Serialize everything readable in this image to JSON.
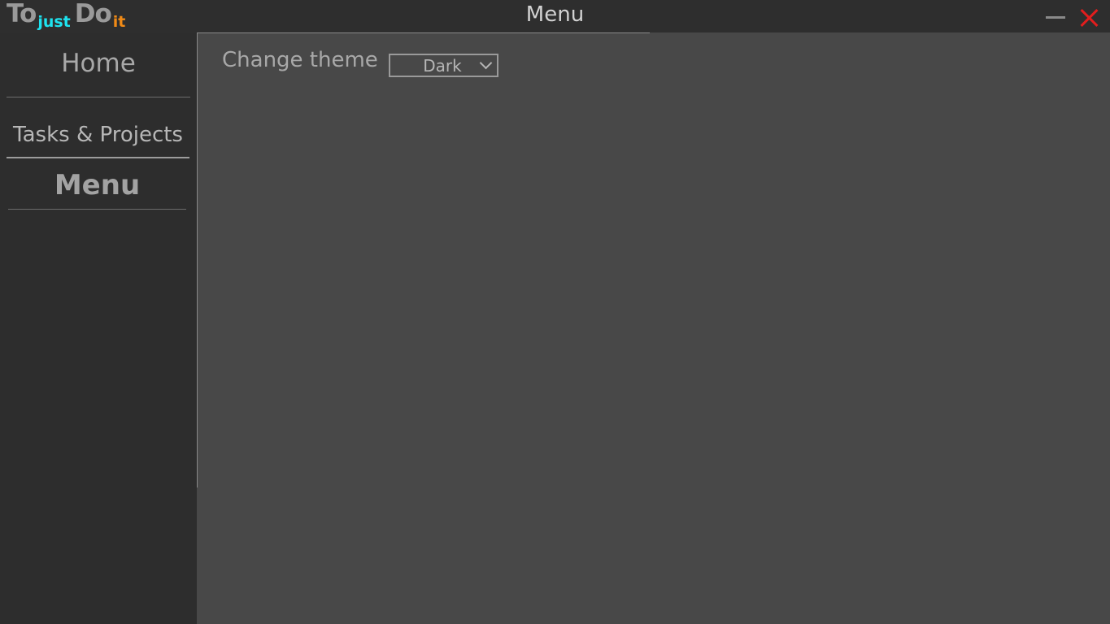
{
  "app": {
    "logo": {
      "word1": "To",
      "word2": "just",
      "word3": "Do",
      "word4": "it",
      "word2_color": "#1ee3ef",
      "word4_color": "#f08a16"
    },
    "window_title": "Menu"
  },
  "window_controls": {
    "minimize_icon": "minimize-icon",
    "close_icon": "close-icon",
    "close_color": "#e21d1d"
  },
  "sidebar": {
    "items": [
      {
        "label": "Home"
      },
      {
        "label": "Tasks & Projects"
      },
      {
        "label": "Menu",
        "active": true
      }
    ]
  },
  "settings": {
    "theme_label": "Change theme",
    "theme_value": "Dark"
  },
  "colors": {
    "sidebar_bg": "#2d2d2d",
    "content_bg": "#484848",
    "text": "#a8a8a8"
  }
}
